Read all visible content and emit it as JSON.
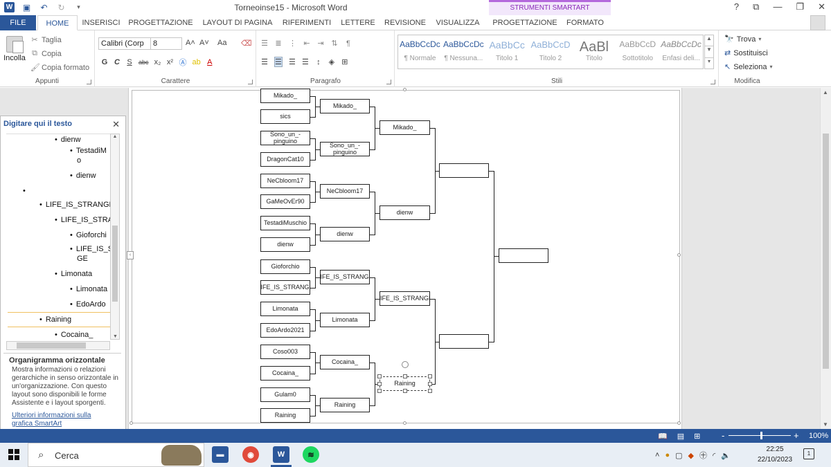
{
  "window": {
    "title": "Torneoinse15 - Microsoft Word",
    "contextual_tab_group": "STRUMENTI SMARTART",
    "controls": [
      "?",
      "⧉",
      "—",
      "❐",
      "✕"
    ]
  },
  "tabs": [
    {
      "label": "FILE"
    },
    {
      "label": "HOME"
    },
    {
      "label": "INSERISCI"
    },
    {
      "label": "PROGETTAZIONE"
    },
    {
      "label": "LAYOUT DI PAGINA"
    },
    {
      "label": "RIFERIMENTI"
    },
    {
      "label": "LETTERE"
    },
    {
      "label": "REVISIONE"
    },
    {
      "label": "VISUALIZZA"
    },
    {
      "label": "PROGETTAZIONE"
    },
    {
      "label": "FORMATO"
    }
  ],
  "ribbon": {
    "clipboard": {
      "paste": "Incolla",
      "cut": "Taglia",
      "copy": "Copia",
      "format_painter": "Copia formato",
      "label": "Appunti"
    },
    "font": {
      "name": "Calibri (Corp",
      "size": "8",
      "bold": "G",
      "italic": "C",
      "underline": "S",
      "strike": "abc",
      "sub": "x₂",
      "sup": "x²",
      "grow": "A˄",
      "shrink": "A˅",
      "case": "Aa",
      "label": "Carattere"
    },
    "paragraph": {
      "label": "Paragrafo"
    },
    "styles": {
      "items": [
        {
          "preview": "AaBbCcDc",
          "name": "¶ Normale"
        },
        {
          "preview": "AaBbCcDc",
          "name": "¶ Nessuna..."
        },
        {
          "preview": "AaBbCc",
          "name": "Titolo 1"
        },
        {
          "preview": "AaBbCcD",
          "name": "Titolo 2"
        },
        {
          "preview": "AaBl",
          "name": "Titolo"
        },
        {
          "preview": "AaBbCcD",
          "name": "Sottotitolo"
        },
        {
          "preview": "AaBbCcDc",
          "name": "Enfasi deli..."
        }
      ],
      "label": "Stili"
    },
    "editing": {
      "find": "Trova",
      "replace": "Sostituisci",
      "select": "Seleziona",
      "label": "Modifica"
    }
  },
  "text_pane": {
    "title": "Digitare qui il testo",
    "items": [
      {
        "text": "dienw",
        "level": 3
      },
      {
        "text": "TestadiM",
        "level": 4
      },
      {
        "text": "o",
        "level": 4
      },
      {
        "text": "dienw",
        "level": 4
      },
      {
        "text": "",
        "level": 1
      },
      {
        "text": "LIFE_IS_STRANGE",
        "level": 2
      },
      {
        "text": "LIFE_IS_STRAN",
        "level": 3
      },
      {
        "text": "Gioforchi",
        "level": 4
      },
      {
        "text": "LIFE_IS_S",
        "level": 4
      },
      {
        "text": "GE",
        "level": 4
      },
      {
        "text": "Limonata",
        "level": 3
      },
      {
        "text": "Limonata",
        "level": 4
      },
      {
        "text": "EdoArdo",
        "level": 4
      },
      {
        "text": "Raining",
        "level": 2
      },
      {
        "text": "Cocaina_",
        "level": 3
      }
    ],
    "layout_title": "Organigramma orizzontale",
    "layout_desc": "Mostra informazioni o relazioni gerarchiche in senso orizzontale in un'organizzazione. Con questo layout sono disponibili le forme Assistente e i layout sporgenti.",
    "more_link": "Ulteriori informazioni sulla grafica SmartArt"
  },
  "bracket": {
    "round1": [
      "Mikado_",
      "sics",
      "Sono_un_-pinguino",
      "DragonCat10",
      "NeCbloom17",
      "GaMeOvEr90",
      "TestadiMuschio",
      "dienw",
      "Gioforchio",
      "LIFE_IS_STRANGE",
      "Limonata",
      "EdoArdo2021",
      "Coso003",
      "Cocaina_",
      "Gulam0",
      "Raining"
    ],
    "round2": [
      "Mikado_",
      "Sono_un_-pinguino",
      "NeCbloom17",
      "dienw",
      "LIFE_IS_STRANGE",
      "Limonata",
      "Cocaina_",
      "Raining"
    ],
    "round3": [
      "Mikado_",
      "dienw",
      "LIFE_IS_STRANGE",
      "Raining"
    ],
    "round4": [
      "",
      ""
    ],
    "final": [
      ""
    ]
  },
  "status": {
    "zoom": "100%",
    "minus": "-",
    "plus": "+"
  },
  "taskbar": {
    "search_label": "Cerca",
    "time": "22:25",
    "date": "22/10/2023"
  }
}
